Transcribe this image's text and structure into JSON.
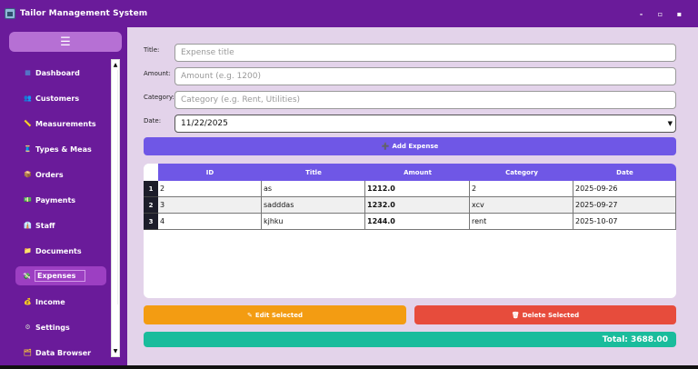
{
  "window": {
    "title": "Tailor Management System",
    "controls": [
      "-",
      "▫",
      "▪"
    ]
  },
  "sidebar": {
    "menu_icon": "☰",
    "items": [
      {
        "label": "Dashboard",
        "icon": "chart-icon",
        "glyph": "▦",
        "color": "#4aa3df"
      },
      {
        "label": "Customers",
        "icon": "people-icon",
        "glyph": "👥",
        "color": "#e0a040"
      },
      {
        "label": "Measurements",
        "icon": "ruler-icon",
        "glyph": "📏",
        "color": "#e0c040"
      },
      {
        "label": "Types & Meas",
        "icon": "thread-icon",
        "glyph": "🧵",
        "color": "#d45aa0"
      },
      {
        "label": "Orders",
        "icon": "package-icon",
        "glyph": "📦",
        "color": "#c8904a"
      },
      {
        "label": "Payments",
        "icon": "money-icon",
        "glyph": "💵",
        "color": "#e8c440"
      },
      {
        "label": "Staff",
        "icon": "staff-icon",
        "glyph": "👔",
        "color": "#5a8ad8"
      },
      {
        "label": "Documents",
        "icon": "folder-icon",
        "glyph": "📁",
        "color": "#e8b440"
      },
      {
        "label": "Expenses",
        "icon": "receipt-icon",
        "glyph": "💸",
        "color": "#8ab8d8",
        "active": true
      },
      {
        "label": "Income",
        "icon": "moneybag-icon",
        "glyph": "💰",
        "color": "#e8b440"
      },
      {
        "label": "Settings",
        "icon": "gear-icon",
        "glyph": "⚙",
        "color": "#cccccc"
      },
      {
        "label": "Data Browser",
        "icon": "file-icon",
        "glyph": "🗂",
        "color": "#e8b440"
      }
    ]
  },
  "form": {
    "title_label": "Title:",
    "title_placeholder": "Expense title",
    "amount_label": "Amount:",
    "amount_placeholder": "Amount (e.g. 1200)",
    "category_label": "Category:",
    "category_placeholder": "Category (e.g. Rent, Utilities)",
    "date_label": "Date:",
    "date_value": "11/22/2025",
    "add_button": "Add Expense"
  },
  "table": {
    "columns": [
      "ID",
      "Title",
      "Amount",
      "Category",
      "Date"
    ],
    "rows": [
      {
        "num": "1",
        "id": "2",
        "title": "as",
        "amount": "1212.0",
        "category": "2",
        "date": "2025-09-26"
      },
      {
        "num": "2",
        "id": "3",
        "title": "sadddas",
        "amount": "1232.0",
        "category": "xcv",
        "date": "2025-09-27"
      },
      {
        "num": "3",
        "id": "4",
        "title": "kjhku",
        "amount": "1244.0",
        "category": "rent",
        "date": "2025-10-07"
      }
    ]
  },
  "actions": {
    "edit": "Edit Selected",
    "delete": "Delete Selected"
  },
  "total": "Total: 3688.00",
  "colors": {
    "primary": "#6a1b9a",
    "accent": "#6f57e6",
    "edit": "#f39c12",
    "delete": "#e74c3c",
    "total": "#1abc9c",
    "background": "#e3d3ea"
  }
}
